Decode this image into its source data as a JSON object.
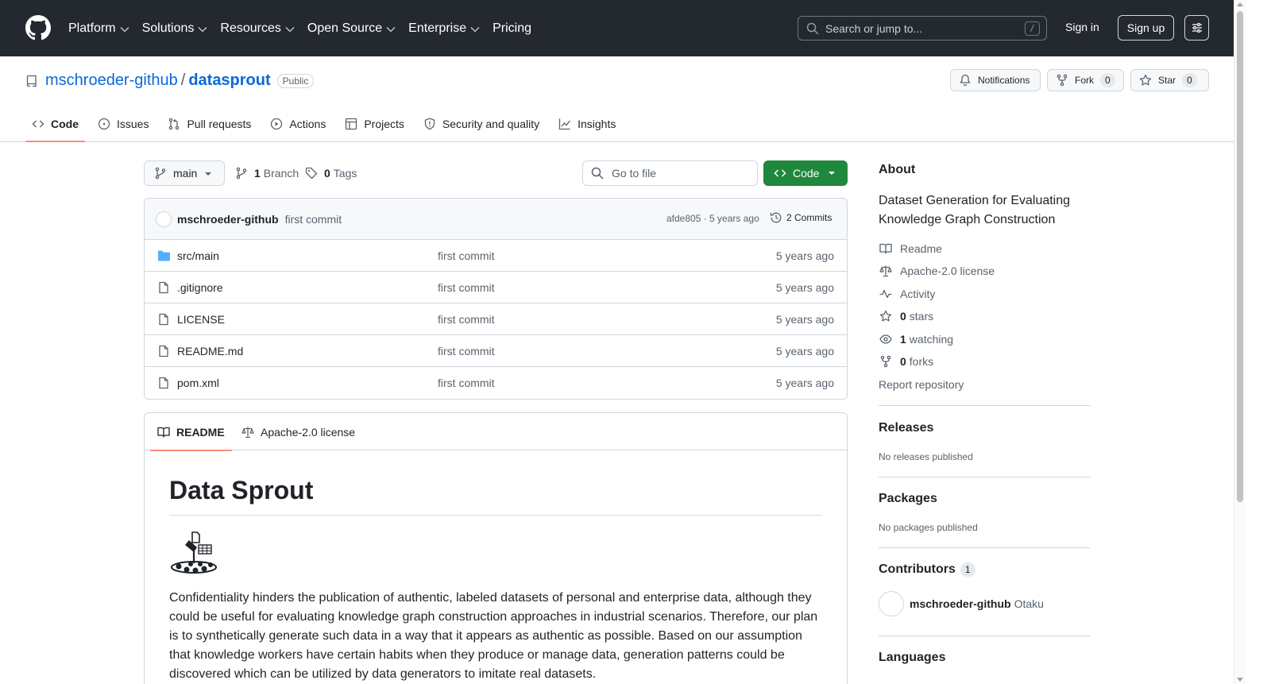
{
  "header": {
    "nav": [
      "Platform",
      "Solutions",
      "Resources",
      "Open Source",
      "Enterprise",
      "Pricing"
    ],
    "search_placeholder": "Search or jump to...",
    "search_shortcut": "/",
    "signin": "Sign in",
    "signup": "Sign up"
  },
  "repo": {
    "owner": "mschroeder-github",
    "separator": "/",
    "name": "datasprout",
    "visibility": "Public",
    "notifications_label": "Notifications",
    "fork_label": "Fork",
    "fork_count": "0",
    "star_label": "Star",
    "star_count": "0"
  },
  "tabs": [
    "Code",
    "Issues",
    "Pull requests",
    "Actions",
    "Projects",
    "Security and quality",
    "Insights"
  ],
  "toolbar": {
    "branch": "main",
    "branch_count": "1",
    "branch_label": "Branch",
    "tag_count": "0",
    "tag_label": "Tags",
    "goto_placeholder": "Go to file",
    "code_label": "Code"
  },
  "latest_commit": {
    "author": "mschroeder-github",
    "message": "first commit",
    "meta": "afde805 · 5 years ago",
    "commits": "2 Commits"
  },
  "files": [
    {
      "name": "src/main",
      "type": "folder",
      "message": "first commit",
      "age": "5 years ago"
    },
    {
      "name": ".gitignore",
      "type": "file",
      "message": "first commit",
      "age": "5 years ago"
    },
    {
      "name": "LICENSE",
      "type": "file",
      "message": "first commit",
      "age": "5 years ago"
    },
    {
      "name": "README.md",
      "type": "file",
      "message": "first commit",
      "age": "5 years ago"
    },
    {
      "name": "pom.xml",
      "type": "file",
      "message": "first commit",
      "age": "5 years ago"
    }
  ],
  "readme": {
    "tabs": [
      "README",
      "Apache-2.0 license"
    ],
    "title": "Data Sprout",
    "paragraph": "Confidentiality hinders the publication of authentic, labeled datasets of personal and enterprise data, although they could be useful for evaluating knowledge graph construction approaches in industrial scenarios. Therefore, our plan is to synthetically generate such data in a way that it appears as authentic as possible. Based on our assumption that knowledge workers have certain habits when they produce or manage data, generation patterns could be discovered which can be utilized by data generators to imitate real datasets."
  },
  "sidebar": {
    "about_title": "About",
    "description": "Dataset Generation for Evaluating Knowledge Graph Construction",
    "readme": "Readme",
    "license": "Apache-2.0 license",
    "activity": "Activity",
    "stars_count": "0",
    "stars_label": "stars",
    "watching_count": "1",
    "watching_label": "watching",
    "forks_count": "0",
    "forks_label": "forks",
    "report": "Report repository",
    "releases_title": "Releases",
    "releases_text": "No releases published",
    "packages_title": "Packages",
    "packages_text": "No packages published",
    "contributors_title": "Contributors",
    "contributors_count": "1",
    "contributor_login": "mschroeder-github",
    "contributor_name": "Otaku",
    "languages_title": "Languages"
  },
  "colors": {
    "header_bg": "#24292f",
    "link": "#0969da",
    "primary_button": "#1f883d",
    "active_tab_underline": "#fd8c73"
  }
}
